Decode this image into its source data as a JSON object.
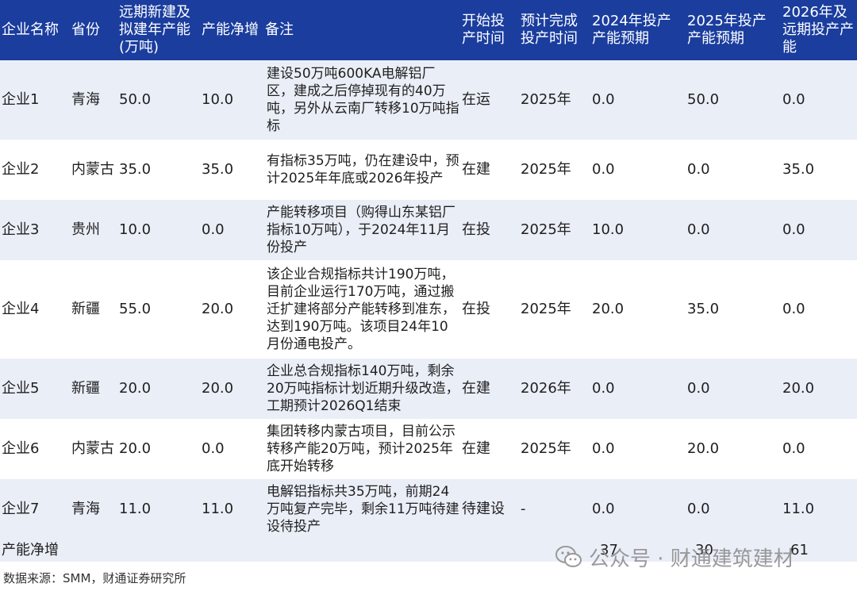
{
  "headers": [
    "企业名称",
    "省份",
    "远期新建及拟建年产能(万吨)",
    "产能净增",
    "备注",
    "开始投产时间",
    "预计完成投产时间",
    "2024年投产产能预期",
    "2025年投产产能预期",
    "2026年及远期投产产能"
  ],
  "rows": [
    {
      "name": "企业1",
      "province": "青海",
      "capacity": "50.0",
      "net": "10.0",
      "note": "建设50万吨600KA电解铝厂区，建成之后停掉现有的40万吨，另外从云南厂转移10万吨指标",
      "start": "在运",
      "finish": "2025年",
      "y2024": "0.0",
      "y2025": "50.0",
      "y2026": "0.0"
    },
    {
      "name": "企业2",
      "province": "内蒙古",
      "capacity": "35.0",
      "net": "35.0",
      "note": "有指标35万吨，仍在建设中，预计2025年年底或2026年投产",
      "start": "在建",
      "finish": "2025年",
      "y2024": "0.0",
      "y2025": "0.0",
      "y2026": "35.0"
    },
    {
      "name": "企业3",
      "province": "贵州",
      "capacity": "10.0",
      "net": "0.0",
      "note": "产能转移项目（购得山东某铝厂指标10万吨），于2024年11月份投产",
      "start": "在投",
      "finish": "2025年",
      "y2024": "10.0",
      "y2025": "0.0",
      "y2026": "0.0"
    },
    {
      "name": "企业4",
      "province": "新疆",
      "capacity": "55.0",
      "net": "20.0",
      "note": "该企业合规指标共计190万吨，目前企业运行170万吨，通过搬迁扩建将部分产能转移到准东，达到190万吨。该项目24年10月份通电投产。",
      "start": "在投",
      "finish": "2025年",
      "y2024": "20.0",
      "y2025": "35.0",
      "y2026": "0.0"
    },
    {
      "name": "企业5",
      "province": "新疆",
      "capacity": "20.0",
      "net": "20.0",
      "note": "企业总合规指标140万吨，剩余20万吨指标计划近期升级改造，工期预计2026Q1结束",
      "start": "在建",
      "finish": "2026年",
      "y2024": "0.0",
      "y2025": "0.0",
      "y2026": "20.0"
    },
    {
      "name": "企业6",
      "province": "内蒙古",
      "capacity": "20.0",
      "net": "0.0",
      "note": "集团转移内蒙古项目，目前公示转移产能20万吨，预计2025年底开始转移",
      "start": "在建",
      "finish": "2025年",
      "y2024": "0.0",
      "y2025": "20.0",
      "y2026": "0.0"
    },
    {
      "name": "企业7",
      "province": "青海",
      "capacity": "11.0",
      "net": "11.0",
      "note": "电解铝指标共35万吨，前期24万吨复产完毕，剩余11万吨待建设待投产",
      "start": "待建设",
      "finish": "-",
      "y2024": "0.0",
      "y2025": "0.0",
      "y2026": "11.0"
    }
  ],
  "total": {
    "label": "产能净增",
    "y2024": "37",
    "y2025": "30",
    "y2026": "61"
  },
  "source": "数据来源：SMM，财通证券研究所",
  "watermark": "公众号 · 财通建筑建材",
  "colors": {
    "header_bg": "#1a3d9e",
    "row_shade": "#eaeef7",
    "watermark_icon": "wechat-icon"
  }
}
